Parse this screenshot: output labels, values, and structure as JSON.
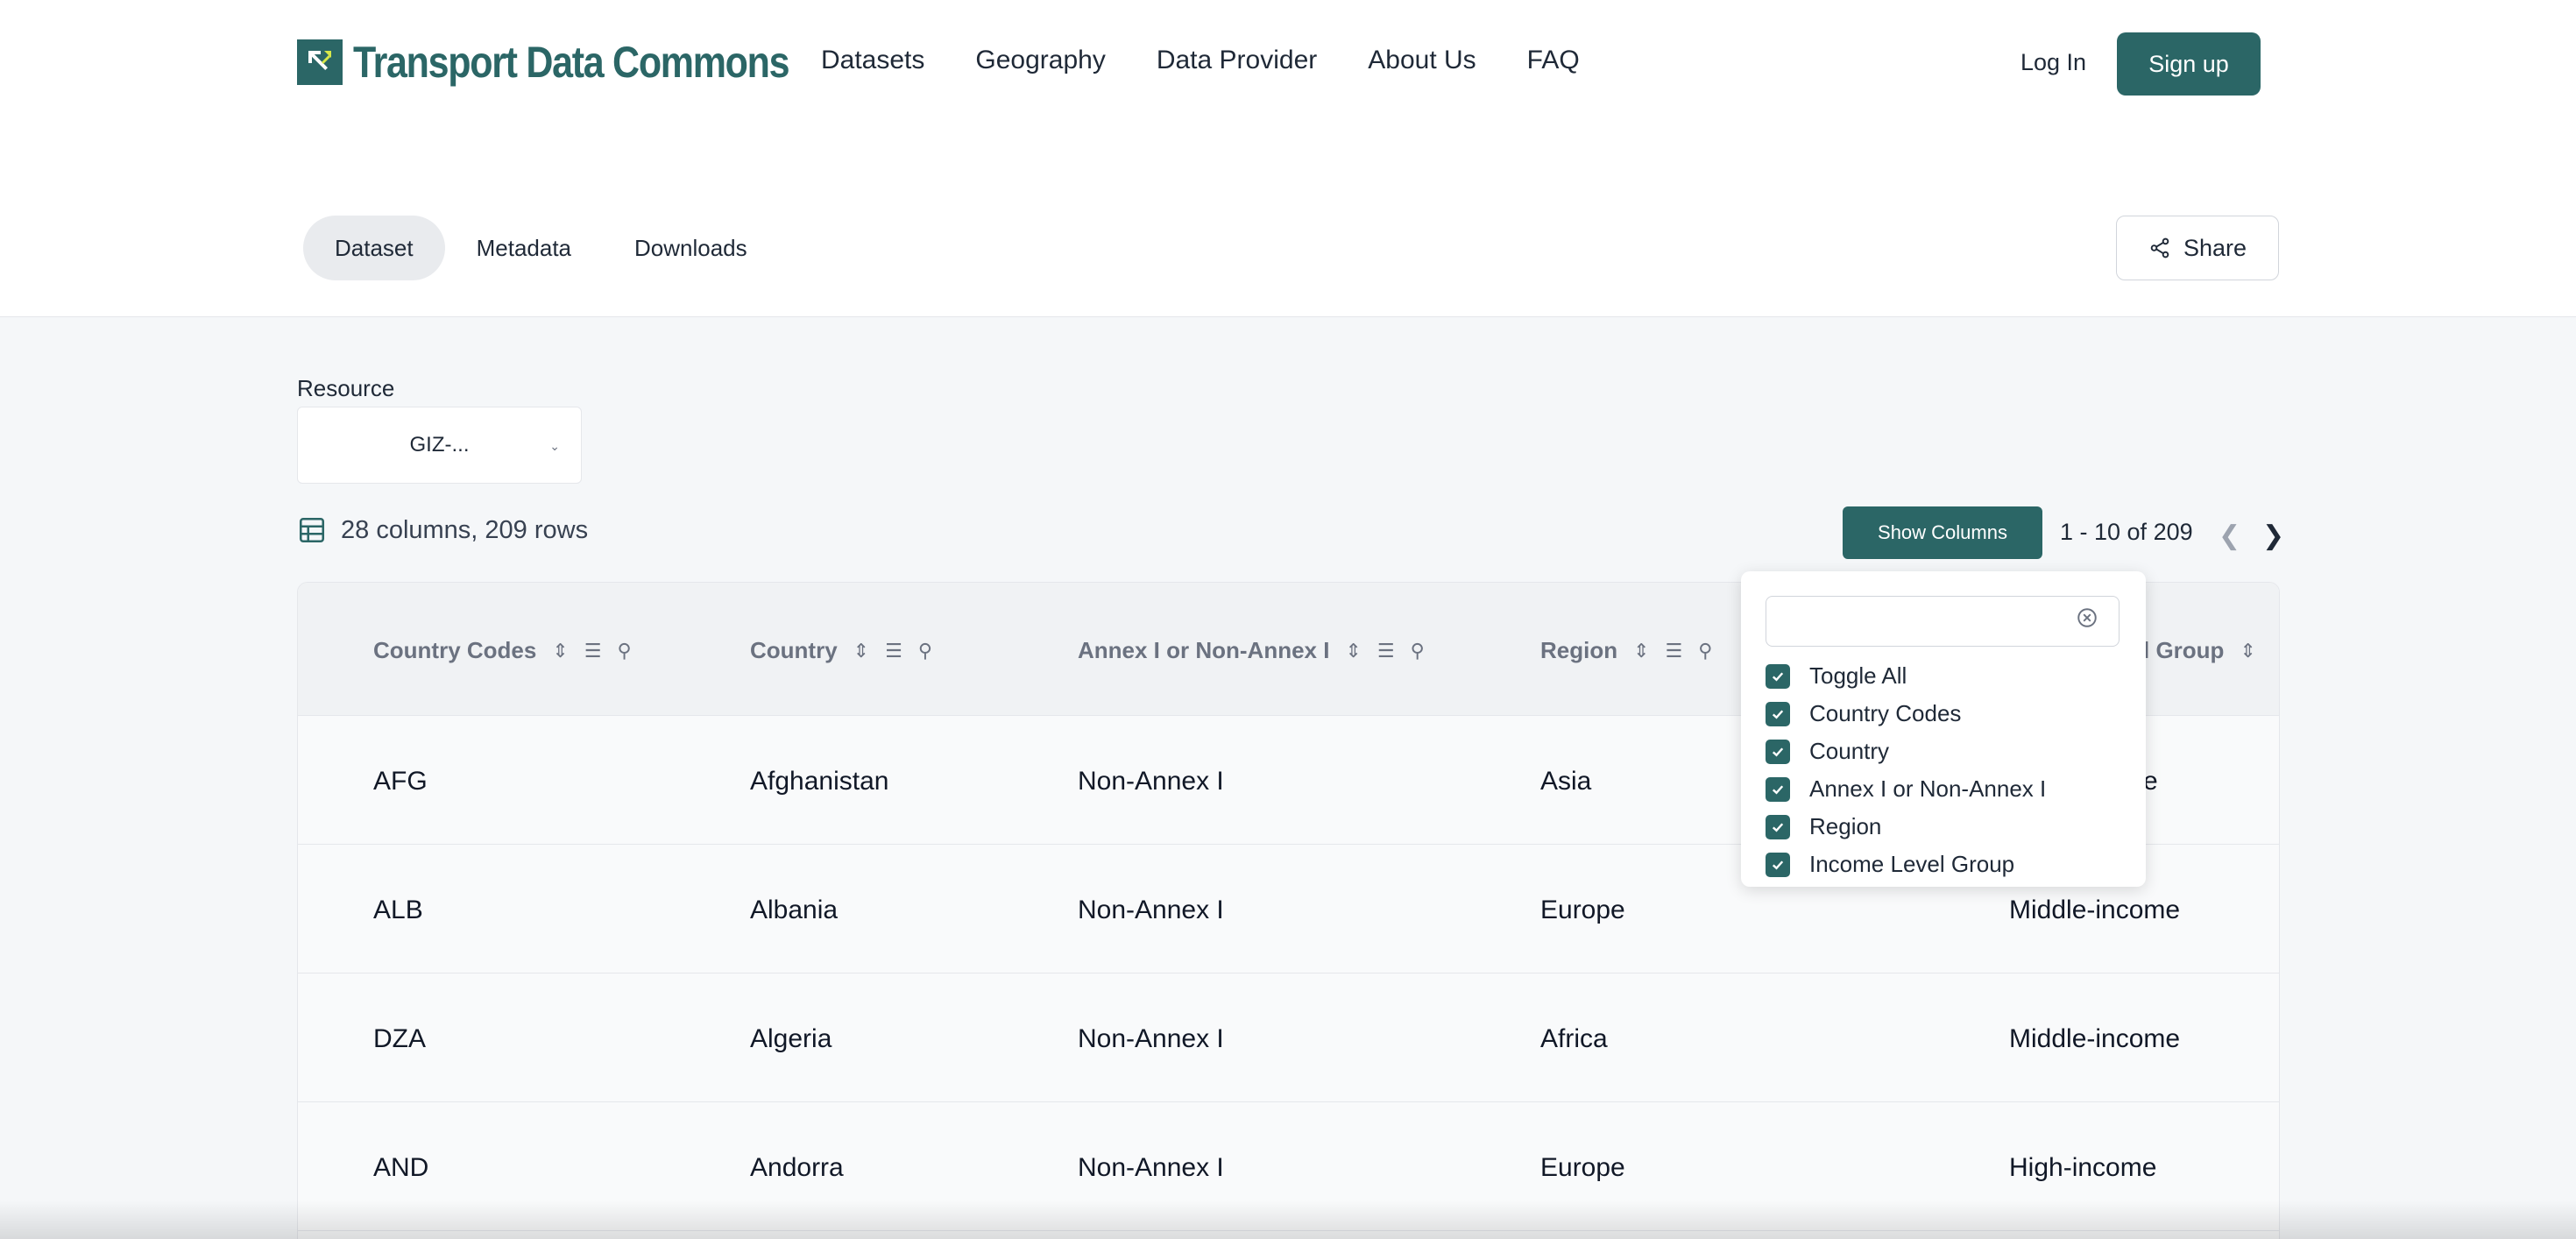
{
  "brand": {
    "name": "Transport Data Commons",
    "color": "#2b6666"
  },
  "nav": [
    {
      "label": "Datasets"
    },
    {
      "label": "Geography"
    },
    {
      "label": "Data Provider"
    },
    {
      "label": "About Us"
    },
    {
      "label": "FAQ"
    }
  ],
  "auth": {
    "login": "Log In",
    "signup": "Sign up"
  },
  "tabs": [
    {
      "label": "Dataset",
      "active": true
    },
    {
      "label": "Metadata"
    },
    {
      "label": "Downloads"
    }
  ],
  "share": {
    "label": "Share",
    "icon": "share-icon"
  },
  "resource": {
    "label": "Resource",
    "value": "GIZ-..."
  },
  "summary": {
    "text": "28 columns, 209 rows",
    "icon": "table-icon"
  },
  "toolbar": {
    "show_columns": "Show Columns",
    "pager": "1 - 10 of 209"
  },
  "table": {
    "columns": [
      "Country Codes",
      "Country",
      "Annex I or Non-Annex I",
      "Region",
      "Income Level Group"
    ],
    "visible_header_fragment": "l Group",
    "rows": [
      [
        "AFG",
        "Afghanistan",
        "Non-Annex I",
        "Asia",
        "Low-income"
      ],
      [
        "ALB",
        "Albania",
        "Non-Annex I",
        "Europe",
        "Middle-income"
      ],
      [
        "DZA",
        "Algeria",
        "Non-Annex I",
        "Africa",
        "Middle-income"
      ],
      [
        "AND",
        "Andorra",
        "Non-Annex I",
        "Europe",
        "High-income"
      ]
    ],
    "visible_partial_cell": "e"
  },
  "columns_popover": {
    "search_value": "",
    "options": [
      {
        "label": "Toggle All",
        "checked": true
      },
      {
        "label": "Country Codes",
        "checked": true
      },
      {
        "label": "Country",
        "checked": true
      },
      {
        "label": "Annex I or Non-Annex I",
        "checked": true
      },
      {
        "label": "Region",
        "checked": true
      },
      {
        "label": "Income Level Group",
        "checked": true
      }
    ]
  },
  "colors": {
    "accent": "#2b6666",
    "background": "#f5f7f9"
  }
}
